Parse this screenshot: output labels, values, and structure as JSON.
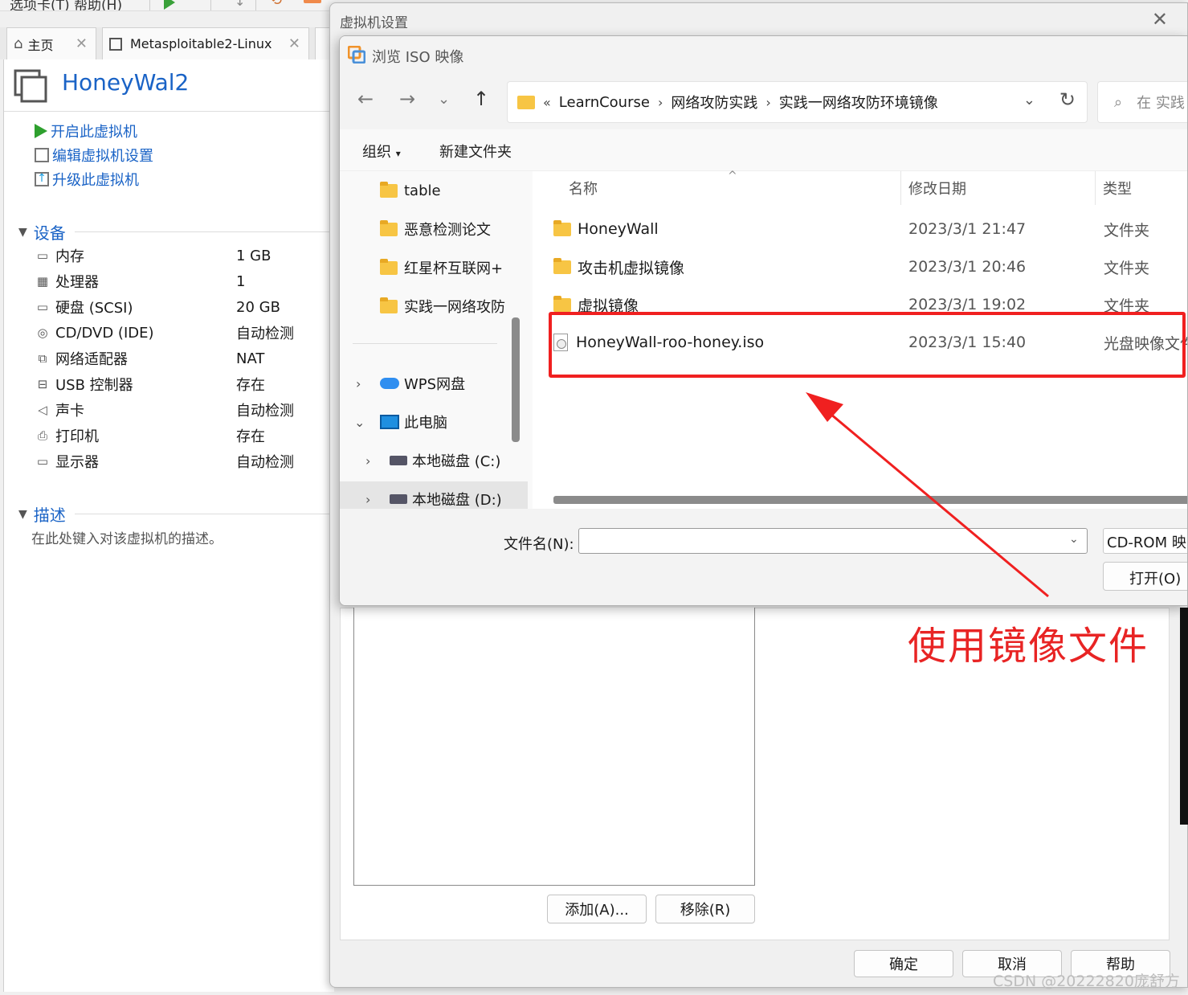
{
  "topbar": {
    "menu": "选项卡(T)  帮助(H)"
  },
  "tabs": [
    {
      "label": "主页"
    },
    {
      "label": "Metasploitable2-Linux"
    }
  ],
  "vm": {
    "title": "HoneyWal2",
    "actions": [
      "开启此虚拟机",
      "编辑虚拟机设置",
      "升级此虚拟机"
    ],
    "devices_header": "设备",
    "devices": [
      {
        "name": "内存",
        "value": "1 GB",
        "icon": "memory-icon"
      },
      {
        "name": "处理器",
        "value": "1",
        "icon": "cpu-icon"
      },
      {
        "name": "硬盘 (SCSI)",
        "value": "20 GB",
        "icon": "harddisk-icon"
      },
      {
        "name": "CD/DVD (IDE)",
        "value": "自动检测",
        "icon": "cd-icon"
      },
      {
        "name": "网络适配器",
        "value": "NAT",
        "icon": "network-icon"
      },
      {
        "name": "USB 控制器",
        "value": "存在",
        "icon": "usb-icon"
      },
      {
        "name": "声卡",
        "value": "自动检测",
        "icon": "speaker-icon"
      },
      {
        "name": "打印机",
        "value": "存在",
        "icon": "printer-icon"
      },
      {
        "name": "显示器",
        "value": "自动检测",
        "icon": "monitor-icon"
      }
    ],
    "desc_header": "描述",
    "desc_placeholder": "在此处键入对该虚拟机的描述。"
  },
  "settings": {
    "title": "虚拟机设置",
    "add_label": "添加(A)...",
    "remove_label": "移除(R)",
    "ok_label": "确定",
    "cancel_label": "取消",
    "help_label": "帮助"
  },
  "browse": {
    "title": "浏览 ISO 映像",
    "breadcrumb": [
      "LearnCourse",
      "网络攻防实践",
      "实践一网络攻防环境镜像"
    ],
    "search_placeholder": "在 实践",
    "toolbar": {
      "organize": "组织",
      "new_folder": "新建文件夹"
    },
    "tree": [
      {
        "label": "table",
        "type": "folder"
      },
      {
        "label": "恶意检测论文",
        "type": "folder"
      },
      {
        "label": "红星杯互联网+",
        "type": "folder"
      },
      {
        "label": "实践一网络攻防",
        "type": "folder"
      },
      {
        "label": "WPS网盘",
        "type": "cloud"
      },
      {
        "label": "此电脑",
        "type": "pc"
      },
      {
        "label": "本地磁盘 (C:)",
        "type": "drive"
      },
      {
        "label": "本地磁盘 (D:)",
        "type": "drive"
      }
    ],
    "columns": {
      "name": "名称",
      "date": "修改日期",
      "type": "类型"
    },
    "files": [
      {
        "name": "HoneyWall",
        "date": "2023/3/1 21:47",
        "type": "文件夹",
        "kind": "folder"
      },
      {
        "name": "攻击机虚拟镜像",
        "date": "2023/3/1 20:46",
        "type": "文件夹",
        "kind": "folder"
      },
      {
        "name": "虚拟镜像",
        "date": "2023/3/1 19:02",
        "type": "文件夹",
        "kind": "folder"
      },
      {
        "name": "HoneyWall-roo-honey.iso",
        "date": "2023/3/1 15:40",
        "type": "光盘映像文件",
        "kind": "iso"
      }
    ],
    "filename_label": "文件名(N):",
    "filename_value": "",
    "filetype": "CD-ROM 映",
    "open_label": "打开(O)"
  },
  "annotation": {
    "text": "使用镜像文件",
    "color": "#e82424"
  },
  "watermark": "CSDN @20222820庞舒方"
}
